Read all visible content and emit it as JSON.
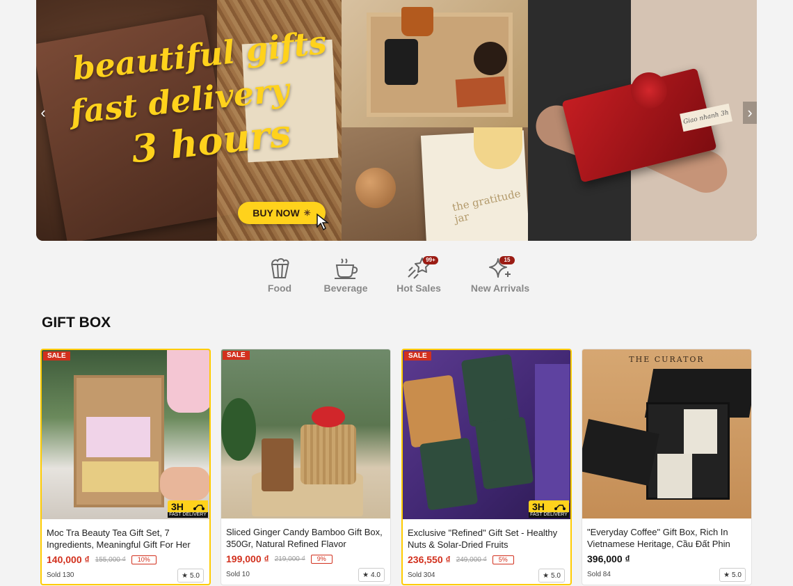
{
  "banner": {
    "headline_line1": "beautiful gifts",
    "headline_line2": "fast delivery",
    "headline_line3": "3 hours",
    "cta_label": "BUY NOW",
    "jar_text": "the gratitude jar",
    "gift_tag": "Giao nhanh 3h"
  },
  "categories": [
    {
      "label": "Food",
      "icon": "popcorn-icon"
    },
    {
      "label": "Beverage",
      "icon": "coffee-cup-icon"
    },
    {
      "label": "Hot Sales",
      "icon": "shooting-star-icon",
      "badge": "99+"
    },
    {
      "label": "New Arrivals",
      "icon": "sparkles-icon",
      "badge": "15"
    }
  ],
  "section_title": "GIFT BOX",
  "fast_delivery": {
    "big": "3H",
    "small": "FAST DELIVERY"
  },
  "sale_label": "SALE",
  "products": [
    {
      "name": "Moc Tra Beauty Tea Gift Set, 7 Ingredients, Meaningful Gift For Her",
      "price": "140,000 ₫",
      "old_price": "155,000 ₫",
      "discount": "10%",
      "sold": "Sold 130",
      "rating": "5.0",
      "sale": true,
      "fast_delivery": true
    },
    {
      "name": "Sliced Ginger Candy Bamboo Gift Box, 350Gr, Natural Refined Flavor",
      "price": "199,000 ₫",
      "old_price": "219,000 ₫",
      "discount": "9%",
      "sold": "Sold 10",
      "rating": "4.0",
      "sale": true,
      "fast_delivery": false
    },
    {
      "name": "Exclusive \"Refined\" Gift Set - Healthy Nuts & Solar-Dried Fruits",
      "price": "236,550 ₫",
      "old_price": "249,000 ₫",
      "discount": "5%",
      "sold": "Sold 304",
      "rating": "5.0",
      "sale": true,
      "fast_delivery": true
    },
    {
      "name": "\"Everyday Coffee\" Gift Box, Rich In Vietnamese Heritage, Cầu Đất Phin",
      "price": "396,000 ₫",
      "sold": "Sold 84",
      "rating": "5.0",
      "sale": false,
      "fast_delivery": false,
      "brand": "THE CURATOR"
    }
  ],
  "colors": {
    "accent": "#ffd21c",
    "price": "#d2301d",
    "badge": "#9b1c14"
  }
}
